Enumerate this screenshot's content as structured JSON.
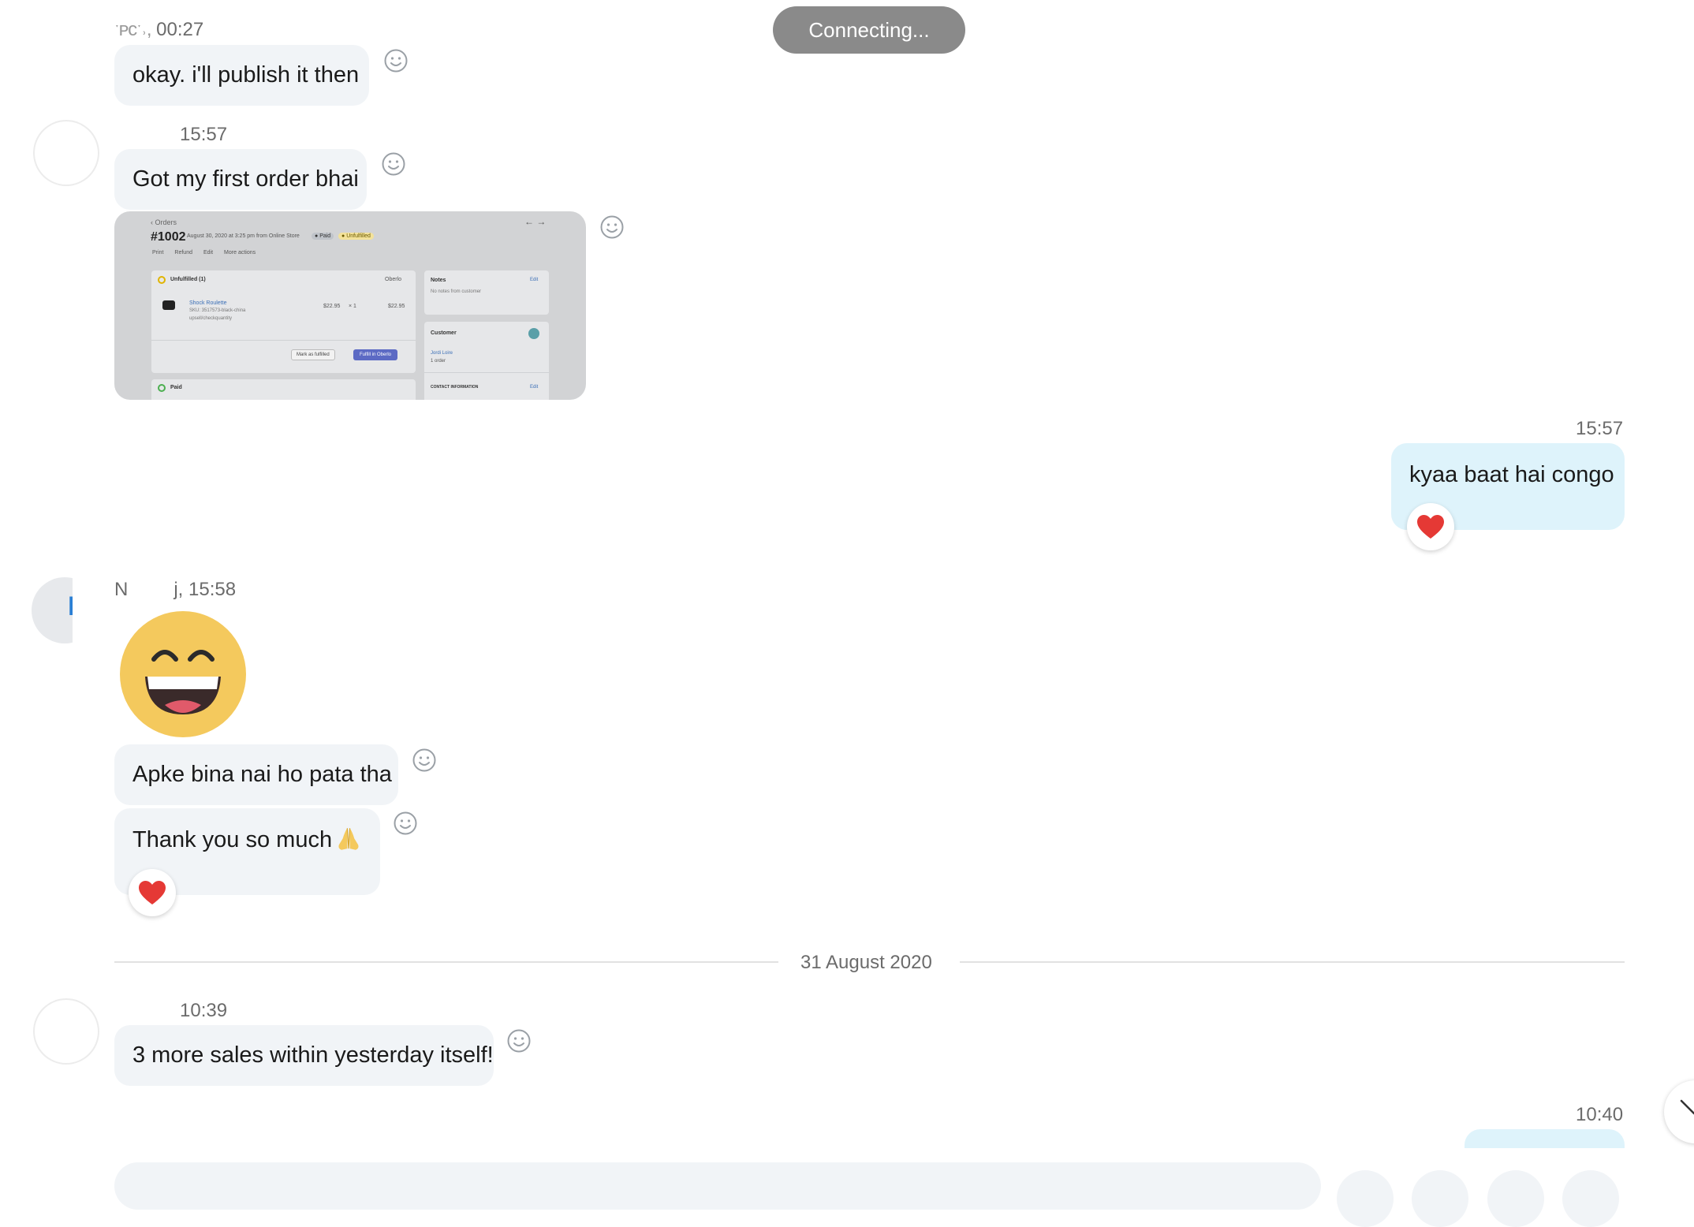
{
  "status": {
    "connecting": "Connecting..."
  },
  "messages": {
    "m1": {
      "timestamp": "00:27",
      "sender_fragment": "ˑᴘᴄˑ˒,",
      "text": "okay. i'll publish it then"
    },
    "m2": {
      "timestamp": "15:57",
      "text": "Got my first order bhai"
    },
    "m3": {
      "timestamp": "15:57",
      "text": "kyaa baat hai congo",
      "reaction": "heart"
    },
    "m4": {
      "sender_initial": "N",
      "timestamp_full": "j, 15:58",
      "avatar_letter": "B",
      "emoji": "laughing-face"
    },
    "m5": {
      "text": "Apke bina nai ho pata tha"
    },
    "m6": {
      "text": "Thank you so much",
      "emoji": "folded-hands",
      "reaction": "heart"
    },
    "m7": {
      "timestamp": "10:39",
      "text": "3 more sales within yesterday itself!"
    },
    "m8": {
      "timestamp": "10:40"
    }
  },
  "date_separator": "31 August 2020",
  "attachment": {
    "back_label": "Orders",
    "order_number": "#1002",
    "order_meta": "August 30, 2020 at 3:25 pm from Online Store",
    "badge_paid": "Paid",
    "badge_unfulfilled": "Unfulfilled",
    "actions": [
      "Print",
      "Refund",
      "Edit",
      "More actions"
    ],
    "unfulfilled_title": "Unfulfilled (1)",
    "unfulfilled_source": "Oberlo",
    "item_name": "Shock Roulette",
    "item_sku": "SKU: 3517573-black-china",
    "item_note": "upsell/checkquantity",
    "item_price": "$22.95",
    "item_qty": "× 1",
    "item_total": "$22.95",
    "btn_mark_fulfilled": "Mark as fulfilled",
    "btn_fulfill_oberlo": "Fulfill in Oberlo",
    "paid_label": "Paid",
    "notes_title": "Notes",
    "notes_edit": "Edit",
    "notes_text": "No notes from customer",
    "customer_title": "Customer",
    "customer_name": "Jordi Loire",
    "customer_orders": "1 order",
    "contact_title": "CONTACT INFORMATION",
    "contact_edit": "Edit"
  },
  "colors": {
    "bubble_incoming": "#f1f4f7",
    "bubble_outgoing": "#def3fb",
    "heart": "#e53935",
    "connecting_bg": "#8a8a8a",
    "fulfill_button": "#5c6ac4"
  }
}
